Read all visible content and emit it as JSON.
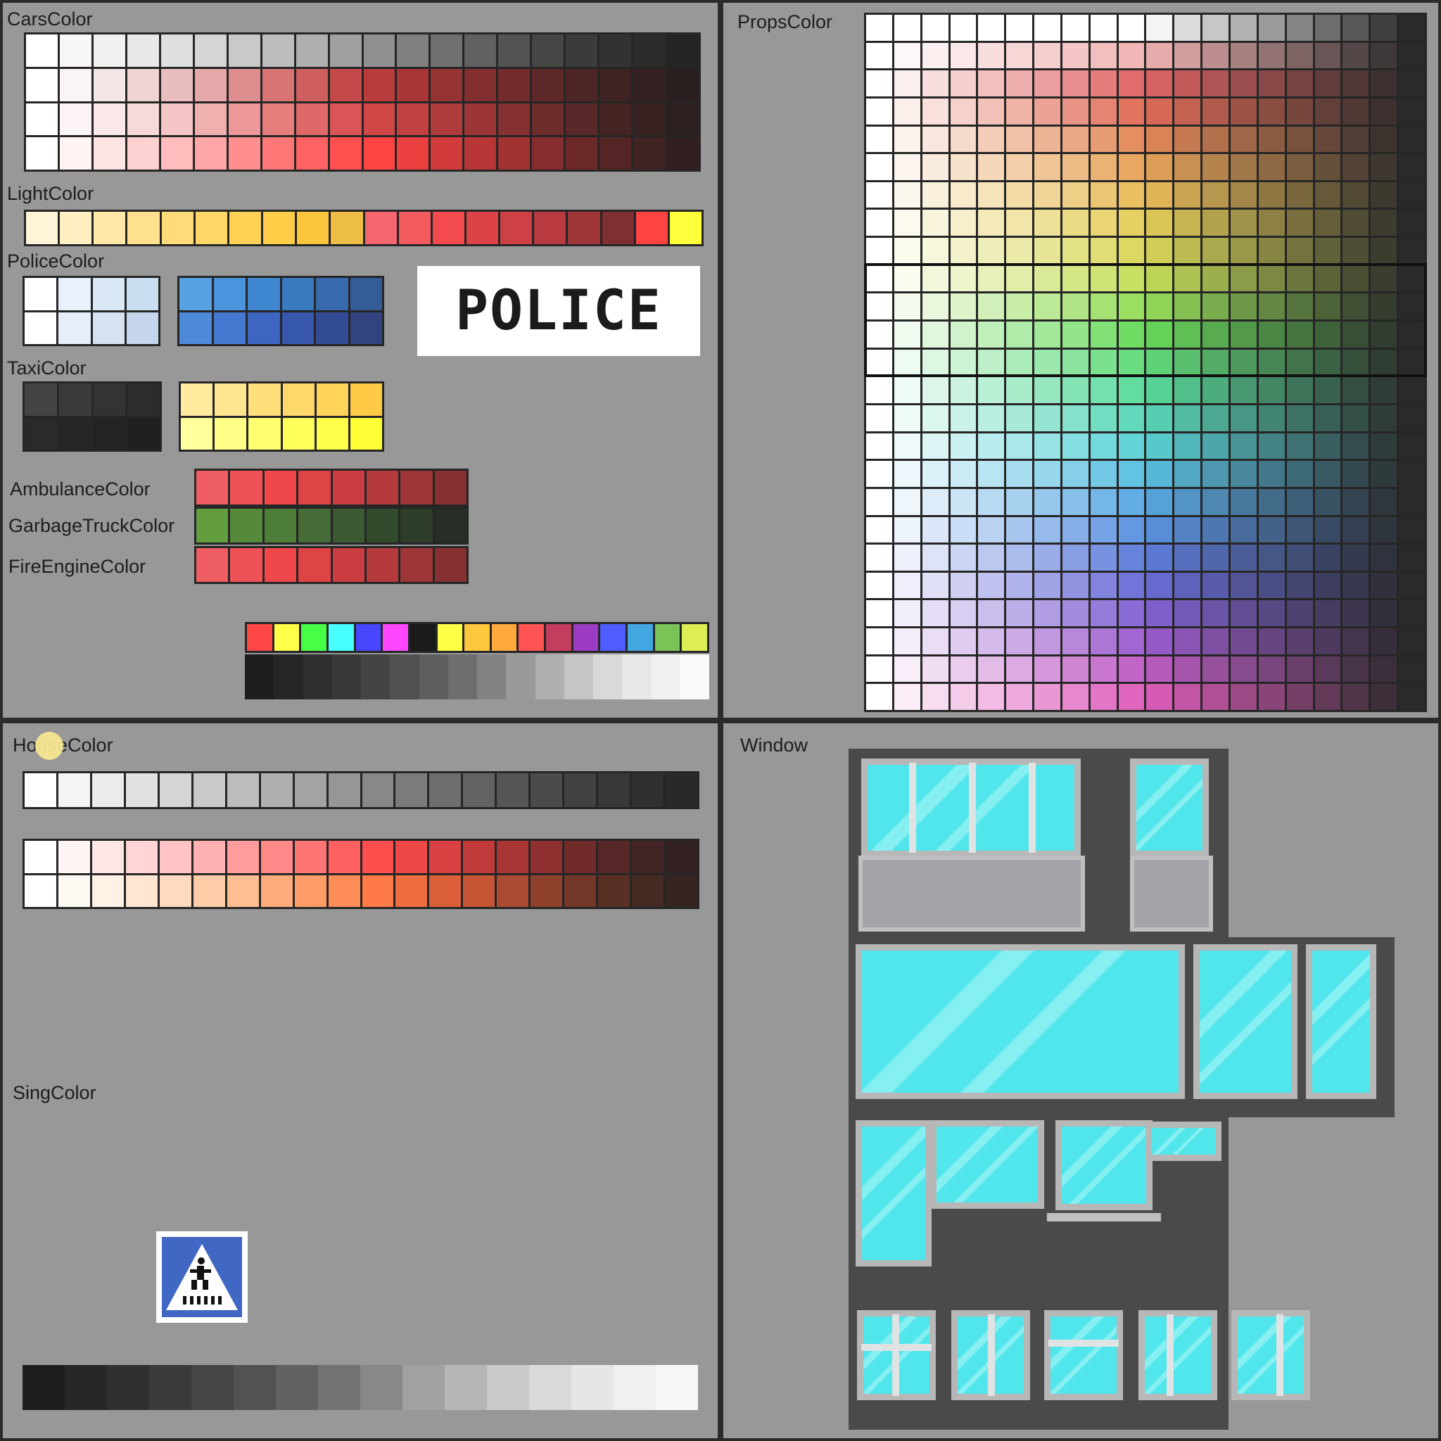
{
  "panels": {
    "cars_color": "CarsColor",
    "light_color": "LightColor",
    "police_color": "PoliceColor",
    "taxi_color": "TaxiColor",
    "ambulance_color": "AmbulanceColor",
    "garbage_truck_color": "GarbageTruckColor",
    "fire_engine_color": "FireEngineColor",
    "props_color": "PropsColor",
    "house_color": "HouseColor",
    "sing_color": "SingColor",
    "window": "Window"
  },
  "police_sign_text": "POLICE",
  "icons": {
    "crosswalk_sign": "pedestrian-crossing-sign-icon",
    "cursor": "cursor-highlight"
  },
  "palettes": {
    "cars": [
      [
        "#ffffff",
        "#f7f7f7",
        "#f0f0f0",
        "#e8e8e8",
        "#dfdfdf",
        "#d5d5d5",
        "#c9c9c9",
        "#bdbdbd",
        "#afafaf",
        "#a0a0a0",
        "#909090",
        "#808080",
        "#707070",
        "#616161",
        "#535353",
        "#464646",
        "#3b3b3b",
        "#323232",
        "#2b2b2b",
        "#252525"
      ],
      [
        "#ffffff",
        "#fbf4f4",
        "#f5e6e6",
        "#efd2d2",
        "#eabebe",
        "#e6a8a8",
        "#df8e8e",
        "#d87474",
        "#cf5e5e",
        "#c44a4a",
        "#b93c3c",
        "#a83636",
        "#953232",
        "#842f2f",
        "#722c2c",
        "#5f2828",
        "#4d2525",
        "#3f2222",
        "#342020",
        "#2a1f1f"
      ],
      [
        "#ffffff",
        "#fdf5f5",
        "#fbe8e8",
        "#f8d9d9",
        "#f5c6c6",
        "#f1b0b0",
        "#ec9898",
        "#e77e7e",
        "#e16868",
        "#da5555",
        "#d24848",
        "#c24141",
        "#af3b3b",
        "#9c3636",
        "#863131",
        "#6f2c2c",
        "#592828",
        "#462424",
        "#372121",
        "#2c1f1f"
      ],
      [
        "#ffffff",
        "#fff3f3",
        "#ffe4e4",
        "#ffd2d2",
        "#ffbdbd",
        "#ffa6a6",
        "#ff8e8e",
        "#ff7777",
        "#ff6262",
        "#ff5050",
        "#ff4444",
        "#ea4040",
        "#d23b3b",
        "#b93636",
        "#a03232",
        "#862d2d",
        "#6d2929",
        "#552525",
        "#412222",
        "#322020"
      ]
    ],
    "light": [
      "#fff4d8",
      "#ffefc2",
      "#ffe8a8",
      "#ffe08d",
      "#ffdb7a",
      "#ffd769",
      "#ffd256",
      "#ffcd47",
      "#fcc63c",
      "#eebd44",
      "#f36670",
      "#f35a5d",
      "#f24a4d",
      "#dd4247",
      "#cd4046",
      "#b8393f",
      "#9f3439",
      "#7f2e31",
      "#ff4242",
      "#ffff3c"
    ],
    "police_light": [
      [
        "#ffffff",
        "#e9f1fb",
        "#dae8f5",
        "#c9dff1"
      ],
      [
        "#ffffff",
        "#e6eefa",
        "#d6e2f2",
        "#c5d6ec"
      ]
    ],
    "police_blue": [
      [
        "#58a1e2",
        "#4a95dd",
        "#3f87d1",
        "#3a7ac0",
        "#3769ad",
        "#345c97"
      ],
      [
        "#4f89da",
        "#4579d1",
        "#3d66c3",
        "#3757ac",
        "#344b95",
        "#31447f"
      ]
    ],
    "taxi_dark": [
      [
        "#444444",
        "#3b3b3b",
        "#333333",
        "#2c2c2c"
      ],
      [
        "#2a2a2a",
        "#262626",
        "#232323",
        "#202020"
      ]
    ],
    "taxi_yellow": [
      [
        "#ffea9e",
        "#ffe590",
        "#ffdf7c",
        "#ffd86b",
        "#ffd25a",
        "#ffcb47"
      ],
      [
        "#ffff9d",
        "#ffff88",
        "#ffff70",
        "#ffff5c",
        "#ffff4a",
        "#ffff38"
      ]
    ],
    "ambulance": [
      "#ef5e62",
      "#ef5256",
      "#f0474b",
      "#de4346",
      "#ca3e42",
      "#b53a3d",
      "#9e3537",
      "#873032"
    ],
    "garbage": [
      "#629d3f",
      "#568a3a",
      "#4f7d3a",
      "#456b36",
      "#3b5a31",
      "#334b2d",
      "#2d3d29",
      "#272e26"
    ],
    "fire_engine": [
      "#ef5e62",
      "#ef5256",
      "#f0474b",
      "#de4346",
      "#ca3e42",
      "#b53a3d",
      "#9e3537",
      "#873032"
    ],
    "bright_strip": [
      "#ff4747",
      "#ffff48",
      "#47ff47",
      "#47ffff",
      "#4747ff",
      "#ff47ff",
      "#1b1b1b",
      "#ffff48",
      "#ffc83c",
      "#ffa83c",
      "#ff5252",
      "#c43c5e",
      "#9c3cc4",
      "#4f5cff",
      "#44a6e0",
      "#78c456",
      "#dcee54"
    ],
    "gray_strip": [
      "#1e1e1e",
      "#262626",
      "#2f2f2f",
      "#393939",
      "#444444",
      "#505050",
      "#5e5e5e",
      "#6e6e6e",
      "#838383",
      "#999999",
      "#b0b0b0",
      "#c6c6c6",
      "#d9d9d9",
      "#e7e7e7",
      "#f1f1f1",
      "#f9f9f9"
    ],
    "house_gray": [
      "#ffffff",
      "#f5f5f5",
      "#ebebeb",
      "#e1e1e1",
      "#d5d5d5",
      "#c9c9c9",
      "#bdbdbd",
      "#b0b0b0",
      "#a3a3a3",
      "#969696",
      "#888888",
      "#7b7b7b",
      "#6e6e6e",
      "#626262",
      "#565656",
      "#4b4b4b",
      "#414141",
      "#383838",
      "#303030",
      "#292929"
    ],
    "house_warm": [
      [
        "#ffffff",
        "#fff5f5",
        "#ffe6e6",
        "#ffd5d5",
        "#ffc3c3",
        "#ffb0b0",
        "#ff9c9c",
        "#ff8888",
        "#ff7474",
        "#ff6060",
        "#ff4e4e",
        "#ed4747",
        "#d84141",
        "#c23b3b",
        "#a93535",
        "#8e3030",
        "#722b2b",
        "#582727",
        "#432424",
        "#342121"
      ],
      [
        "#ffffff",
        "#fff9f3",
        "#fff1e4",
        "#ffe6d2",
        "#ffdabe",
        "#ffcca8",
        "#ffbd92",
        "#ffac7c",
        "#ff9c68",
        "#ff8b56",
        "#ff7a46",
        "#ee6c3d",
        "#db6039",
        "#c55535",
        "#ab4b31",
        "#8f412d",
        "#733829",
        "#5a3025",
        "#452a22",
        "#352420"
      ]
    ],
    "sing_gray": [
      "#1e1e1e",
      "#272727",
      "#303030",
      "#3a3a3a",
      "#454545",
      "#525252",
      "#616161",
      "#727272",
      "#888888",
      "#a1a1a1",
      "#b6b6b6",
      "#cacaca",
      "#d9d9d9",
      "#e6e6e6",
      "#f0f0f0",
      "#f8f8f8"
    ]
  },
  "props_grid": {
    "columns": 20,
    "rows": 25,
    "row_tint_colors": [
      "#ffffff",
      "#d83838",
      "#e0803c",
      "#e6c03c",
      "#c8d83c",
      "#50d43c",
      "#3cd48c",
      "#3cc8d8",
      "#3c8ce0",
      "#4456d0",
      "#8440c8",
      "#d840b0"
    ],
    "dark_end_color": "#2a2a2a"
  }
}
